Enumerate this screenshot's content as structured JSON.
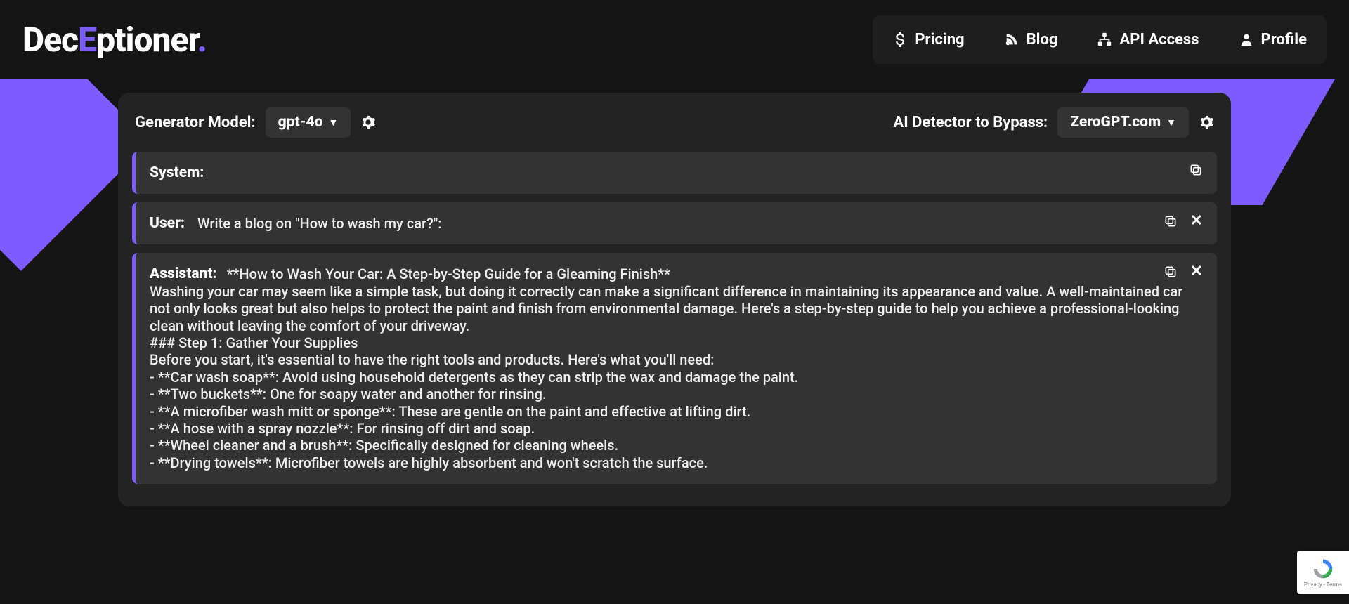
{
  "brand": {
    "part1": "Dec",
    "part2": "E",
    "part3": "ptioner",
    "dot": "."
  },
  "nav": {
    "pricing": "Pricing",
    "blog": "Blog",
    "api": "API Access",
    "profile": "Profile"
  },
  "controls": {
    "model_label": "Generator Model:",
    "model_value": "gpt-4o",
    "detector_label": "AI Detector to Bypass:",
    "detector_value": "ZeroGPT.com"
  },
  "messages": {
    "system_role": "System:",
    "user_role": "User:",
    "user_text": "Write a blog on \"How to wash my car?\":",
    "assistant_role": "Assistant:",
    "assistant_text": "**How to Wash Your Car: A Step-by-Step Guide for a Gleaming Finish**\nWashing your car may seem like a simple task, but doing it correctly can make a significant difference in maintaining its appearance and value. A well-maintained car not only looks great but also helps to protect the paint and finish from environmental damage. Here's a step-by-step guide to help you achieve a professional-looking clean without leaving the comfort of your driveway.\n### Step 1: Gather Your Supplies\nBefore you start, it's essential to have the right tools and products. Here's what you'll need:\n- **Car wash soap**: Avoid using household detergents as they can strip the wax and damage the paint.\n- **Two buckets**: One for soapy water and another for rinsing.\n- **A microfiber wash mitt or sponge**: These are gentle on the paint and effective at lifting dirt.\n- **A hose with a spray nozzle**: For rinsing off dirt and soap.\n- **Wheel cleaner and a brush**: Specifically designed for cleaning wheels.\n- **Drying towels**: Microfiber towels are highly absorbent and won't scratch the surface."
  },
  "recaptcha": {
    "footer": "Privacy - Terms"
  }
}
